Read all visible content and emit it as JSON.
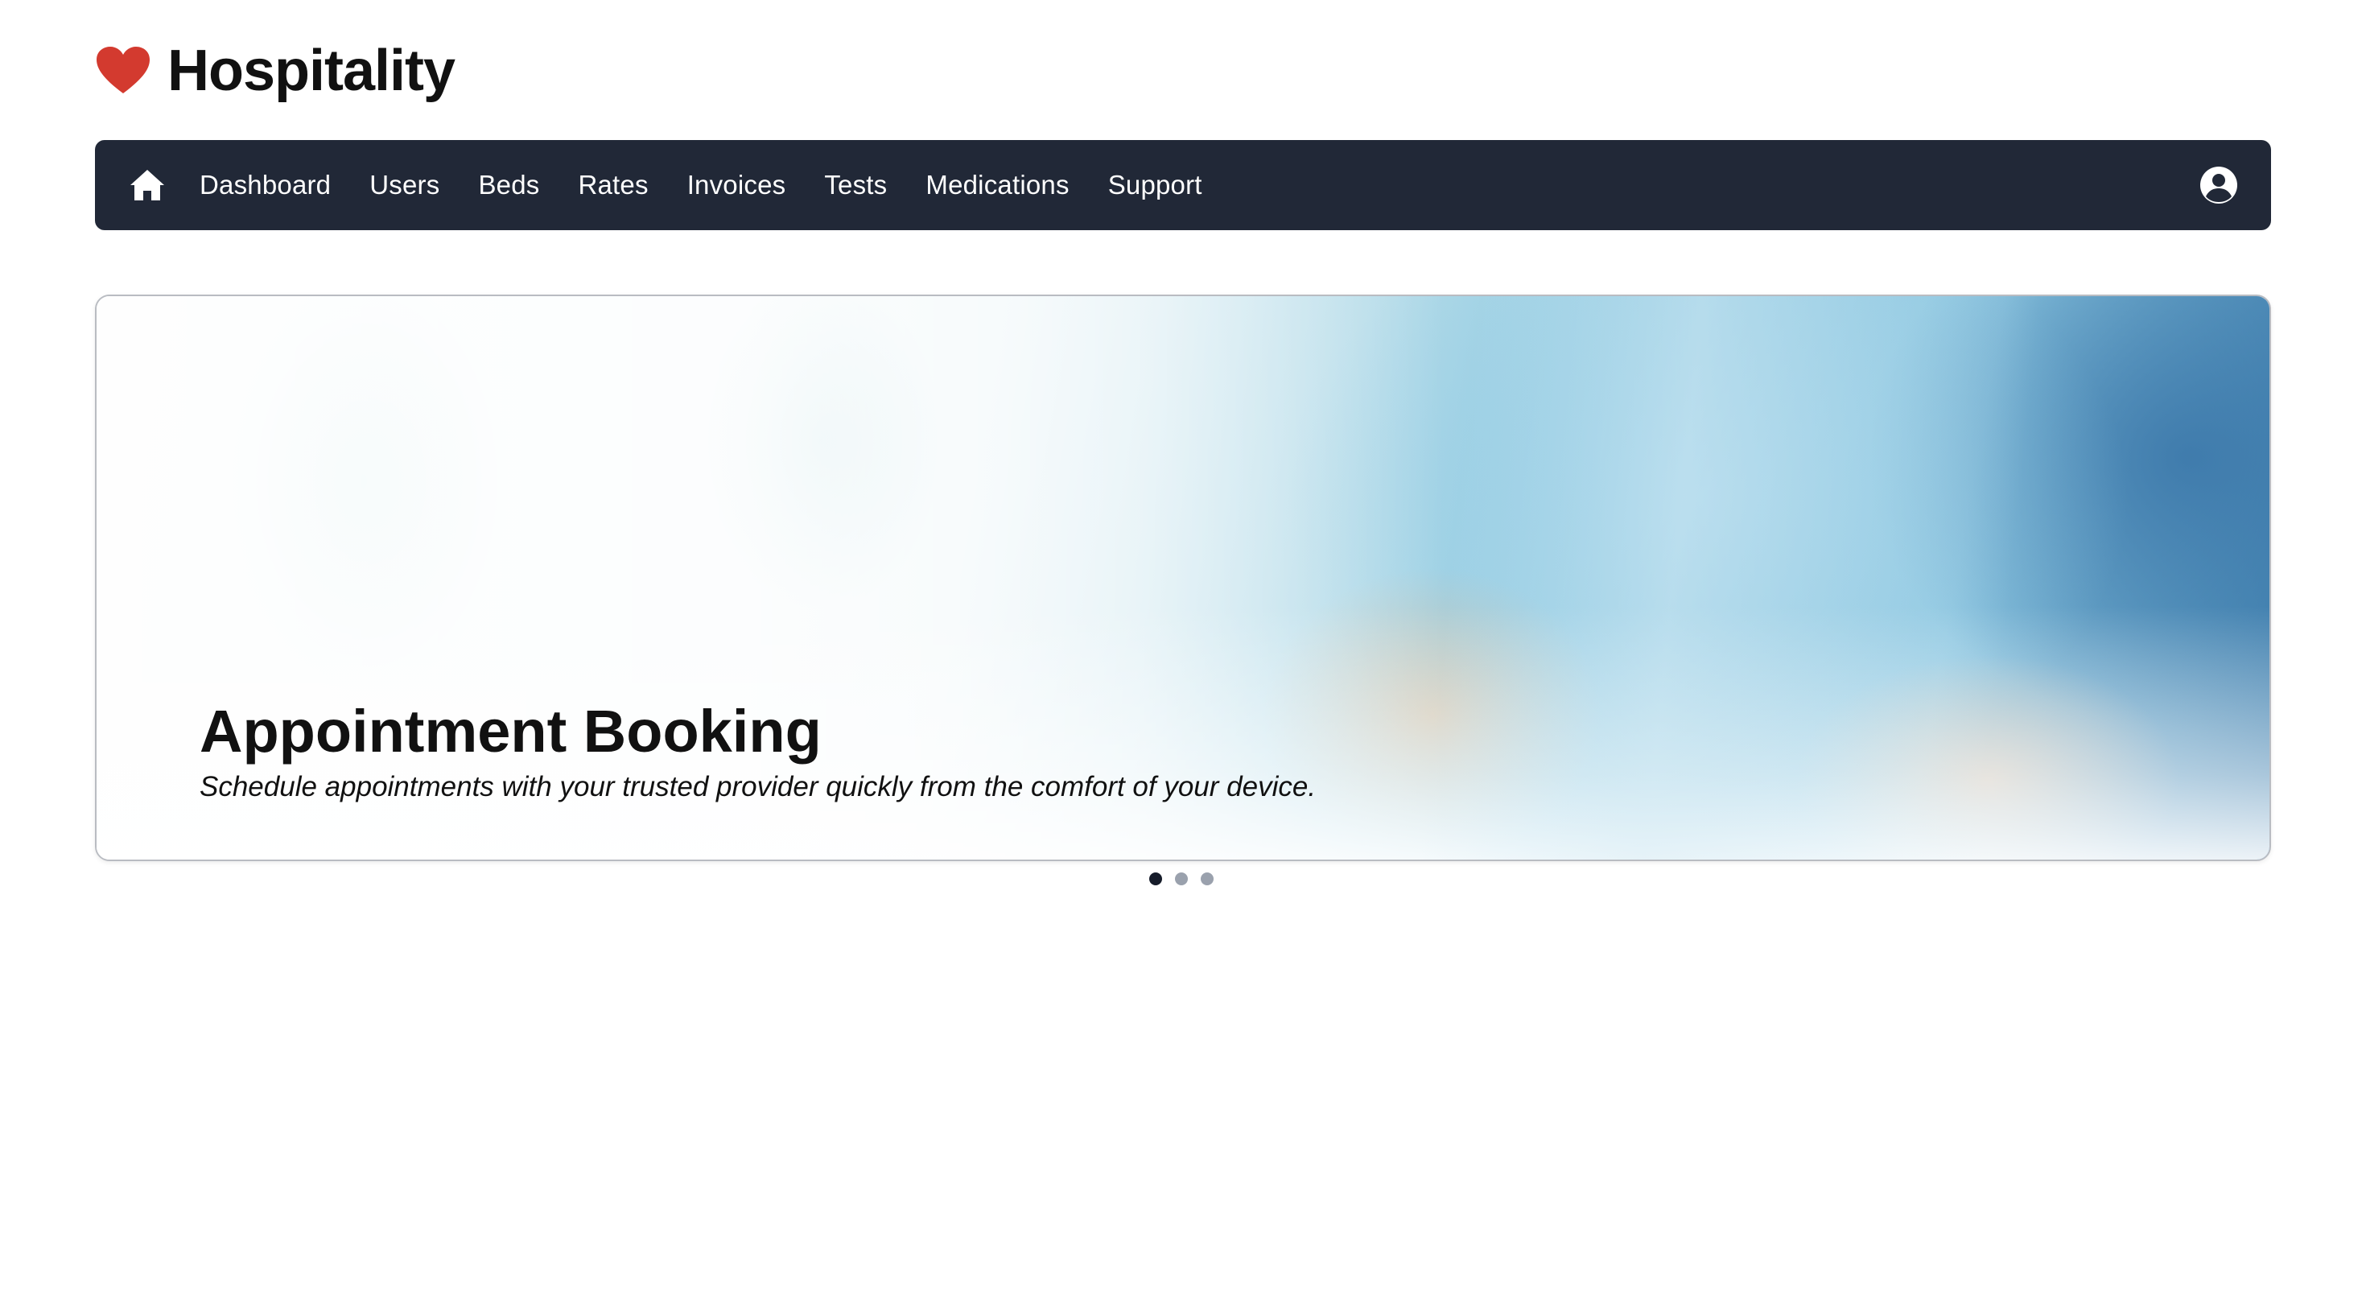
{
  "brand": {
    "title": "Hospitality",
    "icon": "heart-icon",
    "icon_color": "#d33a2f"
  },
  "navbar": {
    "background": "#212837",
    "home_icon": "home-icon",
    "items": [
      {
        "label": "Dashboard"
      },
      {
        "label": "Users"
      },
      {
        "label": "Beds"
      },
      {
        "label": "Rates"
      },
      {
        "label": "Invoices"
      },
      {
        "label": "Tests"
      },
      {
        "label": "Medications"
      },
      {
        "label": "Support"
      }
    ],
    "user_icon": "user-circle-icon"
  },
  "carousel": {
    "active_slide": 1,
    "slide_count": 3,
    "slide": {
      "title": "Appointment Booking",
      "text": "Schedule appointments with your trusted provider quickly from the comfort of your device."
    },
    "indicator_active_color": "#161c2a",
    "indicator_inactive_color": "#9aa1ad"
  }
}
